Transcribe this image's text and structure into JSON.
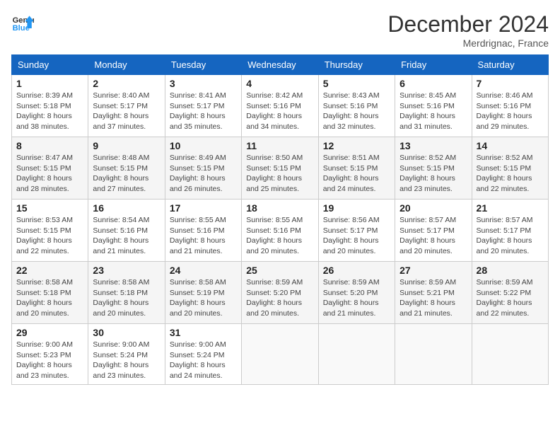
{
  "header": {
    "logo_line1": "General",
    "logo_line2": "Blue",
    "month": "December 2024",
    "location": "Merdrignac, France"
  },
  "days_of_week": [
    "Sunday",
    "Monday",
    "Tuesday",
    "Wednesday",
    "Thursday",
    "Friday",
    "Saturday"
  ],
  "weeks": [
    [
      {
        "day": 1,
        "info": "Sunrise: 8:39 AM\nSunset: 5:18 PM\nDaylight: 8 hours\nand 38 minutes."
      },
      {
        "day": 2,
        "info": "Sunrise: 8:40 AM\nSunset: 5:17 PM\nDaylight: 8 hours\nand 37 minutes."
      },
      {
        "day": 3,
        "info": "Sunrise: 8:41 AM\nSunset: 5:17 PM\nDaylight: 8 hours\nand 35 minutes."
      },
      {
        "day": 4,
        "info": "Sunrise: 8:42 AM\nSunset: 5:16 PM\nDaylight: 8 hours\nand 34 minutes."
      },
      {
        "day": 5,
        "info": "Sunrise: 8:43 AM\nSunset: 5:16 PM\nDaylight: 8 hours\nand 32 minutes."
      },
      {
        "day": 6,
        "info": "Sunrise: 8:45 AM\nSunset: 5:16 PM\nDaylight: 8 hours\nand 31 minutes."
      },
      {
        "day": 7,
        "info": "Sunrise: 8:46 AM\nSunset: 5:16 PM\nDaylight: 8 hours\nand 29 minutes."
      }
    ],
    [
      {
        "day": 8,
        "info": "Sunrise: 8:47 AM\nSunset: 5:15 PM\nDaylight: 8 hours\nand 28 minutes."
      },
      {
        "day": 9,
        "info": "Sunrise: 8:48 AM\nSunset: 5:15 PM\nDaylight: 8 hours\nand 27 minutes."
      },
      {
        "day": 10,
        "info": "Sunrise: 8:49 AM\nSunset: 5:15 PM\nDaylight: 8 hours\nand 26 minutes."
      },
      {
        "day": 11,
        "info": "Sunrise: 8:50 AM\nSunset: 5:15 PM\nDaylight: 8 hours\nand 25 minutes."
      },
      {
        "day": 12,
        "info": "Sunrise: 8:51 AM\nSunset: 5:15 PM\nDaylight: 8 hours\nand 24 minutes."
      },
      {
        "day": 13,
        "info": "Sunrise: 8:52 AM\nSunset: 5:15 PM\nDaylight: 8 hours\nand 23 minutes."
      },
      {
        "day": 14,
        "info": "Sunrise: 8:52 AM\nSunset: 5:15 PM\nDaylight: 8 hours\nand 22 minutes."
      }
    ],
    [
      {
        "day": 15,
        "info": "Sunrise: 8:53 AM\nSunset: 5:15 PM\nDaylight: 8 hours\nand 22 minutes."
      },
      {
        "day": 16,
        "info": "Sunrise: 8:54 AM\nSunset: 5:16 PM\nDaylight: 8 hours\nand 21 minutes."
      },
      {
        "day": 17,
        "info": "Sunrise: 8:55 AM\nSunset: 5:16 PM\nDaylight: 8 hours\nand 21 minutes."
      },
      {
        "day": 18,
        "info": "Sunrise: 8:55 AM\nSunset: 5:16 PM\nDaylight: 8 hours\nand 20 minutes."
      },
      {
        "day": 19,
        "info": "Sunrise: 8:56 AM\nSunset: 5:17 PM\nDaylight: 8 hours\nand 20 minutes."
      },
      {
        "day": 20,
        "info": "Sunrise: 8:57 AM\nSunset: 5:17 PM\nDaylight: 8 hours\nand 20 minutes."
      },
      {
        "day": 21,
        "info": "Sunrise: 8:57 AM\nSunset: 5:17 PM\nDaylight: 8 hours\nand 20 minutes."
      }
    ],
    [
      {
        "day": 22,
        "info": "Sunrise: 8:58 AM\nSunset: 5:18 PM\nDaylight: 8 hours\nand 20 minutes."
      },
      {
        "day": 23,
        "info": "Sunrise: 8:58 AM\nSunset: 5:18 PM\nDaylight: 8 hours\nand 20 minutes."
      },
      {
        "day": 24,
        "info": "Sunrise: 8:58 AM\nSunset: 5:19 PM\nDaylight: 8 hours\nand 20 minutes."
      },
      {
        "day": 25,
        "info": "Sunrise: 8:59 AM\nSunset: 5:20 PM\nDaylight: 8 hours\nand 20 minutes."
      },
      {
        "day": 26,
        "info": "Sunrise: 8:59 AM\nSunset: 5:20 PM\nDaylight: 8 hours\nand 21 minutes."
      },
      {
        "day": 27,
        "info": "Sunrise: 8:59 AM\nSunset: 5:21 PM\nDaylight: 8 hours\nand 21 minutes."
      },
      {
        "day": 28,
        "info": "Sunrise: 8:59 AM\nSunset: 5:22 PM\nDaylight: 8 hours\nand 22 minutes."
      }
    ],
    [
      {
        "day": 29,
        "info": "Sunrise: 9:00 AM\nSunset: 5:23 PM\nDaylight: 8 hours\nand 23 minutes."
      },
      {
        "day": 30,
        "info": "Sunrise: 9:00 AM\nSunset: 5:24 PM\nDaylight: 8 hours\nand 23 minutes."
      },
      {
        "day": 31,
        "info": "Sunrise: 9:00 AM\nSunset: 5:24 PM\nDaylight: 8 hours\nand 24 minutes."
      },
      null,
      null,
      null,
      null
    ]
  ]
}
